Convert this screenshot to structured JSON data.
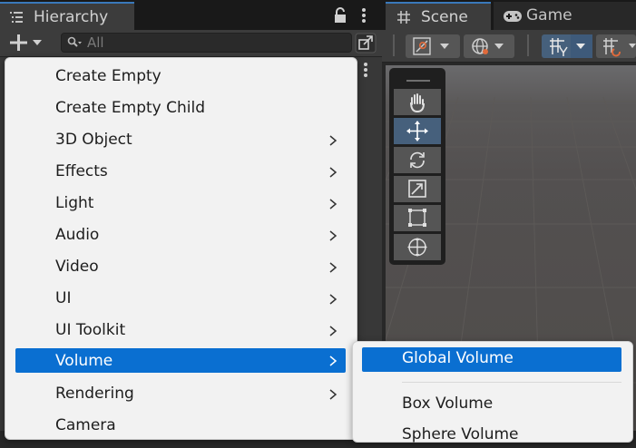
{
  "hierarchy": {
    "tab_label": "Hierarchy",
    "search_placeholder": "All"
  },
  "scene": {
    "tab_scene": "Scene",
    "tab_game": "Game"
  },
  "context_menu": {
    "items": [
      {
        "label": "Create Empty",
        "submenu": false
      },
      {
        "label": "Create Empty Child",
        "submenu": false
      },
      {
        "label": "3D Object",
        "submenu": true
      },
      {
        "label": "Effects",
        "submenu": true
      },
      {
        "label": "Light",
        "submenu": true
      },
      {
        "label": "Audio",
        "submenu": true
      },
      {
        "label": "Video",
        "submenu": true
      },
      {
        "label": "UI",
        "submenu": true
      },
      {
        "label": "UI Toolkit",
        "submenu": true
      },
      {
        "label": "Volume",
        "submenu": true,
        "selected": true
      },
      {
        "label": "Rendering",
        "submenu": true
      },
      {
        "label": "Camera",
        "submenu": false
      }
    ]
  },
  "volume_submenu": {
    "items": [
      {
        "label": "Global Volume",
        "selected": true
      },
      {
        "label": "Box Volume"
      },
      {
        "label": "Sphere Volume"
      }
    ]
  },
  "colors": {
    "accent": "#3a79bb",
    "menu_highlight": "#0a6fd1",
    "tool_active": "#46607c"
  }
}
